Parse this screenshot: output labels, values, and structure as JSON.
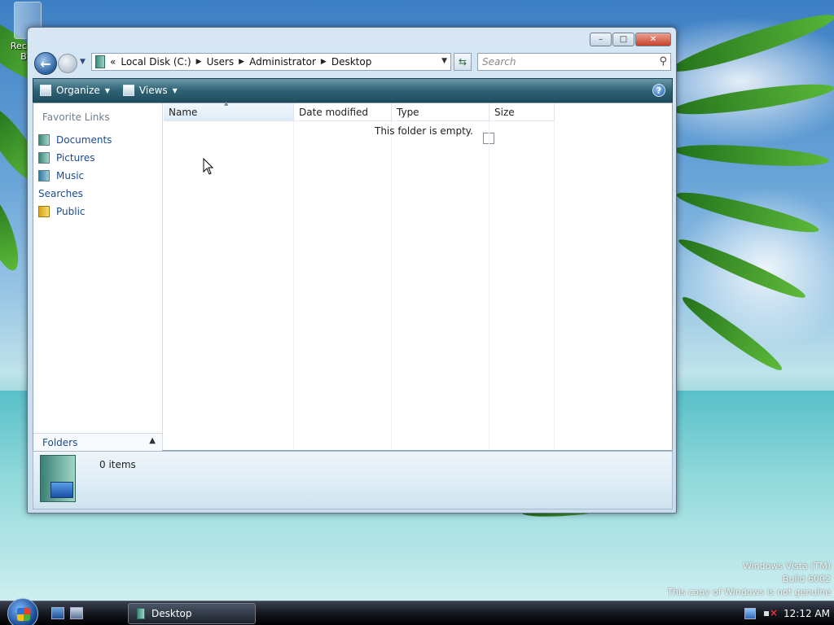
{
  "desktop": {
    "recycle_label": "Recycle Bin",
    "watermark": [
      "Windows Vista (TM)",
      "Build 6002",
      "This copy of Windows is not genuine"
    ]
  },
  "window": {
    "controls": {
      "minimize": "–",
      "maximize": "□",
      "close": "✕"
    },
    "address": {
      "prefix": "«",
      "crumbs": [
        "Local Disk (C:)",
        "Users",
        "Administrator",
        "Desktop"
      ]
    },
    "search": {
      "placeholder": "Search"
    },
    "toolbar": {
      "organize": "Organize",
      "views": "Views",
      "help": "?"
    },
    "favorites": {
      "title": "Favorite Links",
      "items": [
        "Documents",
        "Pictures",
        "Music",
        "Searches",
        "Public"
      ]
    },
    "folders_label": "Folders",
    "columns": [
      "Name",
      "Date modified",
      "Type",
      "Size"
    ],
    "empty_message": "This folder is empty.",
    "details": {
      "count": "0 items"
    }
  },
  "taskbar": {
    "task": "Desktop",
    "clock": "12:12 AM"
  }
}
